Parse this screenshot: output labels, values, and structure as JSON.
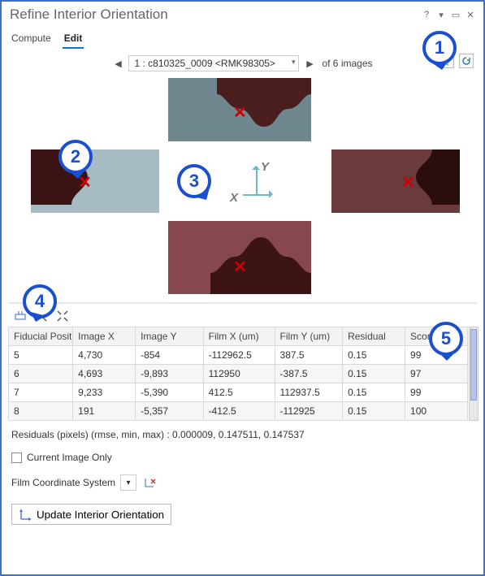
{
  "window": {
    "title": "Refine Interior Orientation"
  },
  "tabs": {
    "compute": "Compute",
    "edit": "Edit"
  },
  "pager": {
    "index": "1",
    "current": "1 : c810325_0009 <RMK98305>",
    "of_label": "of 6 images"
  },
  "callouts": {
    "n1": "1",
    "n2": "2",
    "n3": "3",
    "n4": "4",
    "n5": "5"
  },
  "axis": {
    "x": "X",
    "y": "Y"
  },
  "chart_data": {
    "type": "table",
    "columns": [
      "Fiducial Position",
      "Image X",
      "Image Y",
      "Film X (um)",
      "Film Y (um)",
      "Residual",
      "Score"
    ],
    "rows": [
      {
        "pos": "5",
        "ix": "4,730",
        "iy": "-854",
        "fx": "-112962.5",
        "fy": "387.5",
        "res": "0.15",
        "score": "99"
      },
      {
        "pos": "6",
        "ix": "4,693",
        "iy": "-9,893",
        "fx": "112950",
        "fy": "-387.5",
        "res": "0.15",
        "score": "97"
      },
      {
        "pos": "7",
        "ix": "9,233",
        "iy": "-5,390",
        "fx": "412.5",
        "fy": "112937.5",
        "res": "0.15",
        "score": "99"
      },
      {
        "pos": "8",
        "ix": "191",
        "iy": "-5,357",
        "fx": "-412.5",
        "fy": "-112925",
        "res": "0.15",
        "score": "100"
      }
    ]
  },
  "residuals_label": "Residuals (pixels) (rmse, min, max)  : 0.000009, 0.147511, 0.147537",
  "current_image_only": "Current Image Only",
  "film_cs_label": "Film Coordinate System",
  "update_btn": "Update Interior Orientation"
}
